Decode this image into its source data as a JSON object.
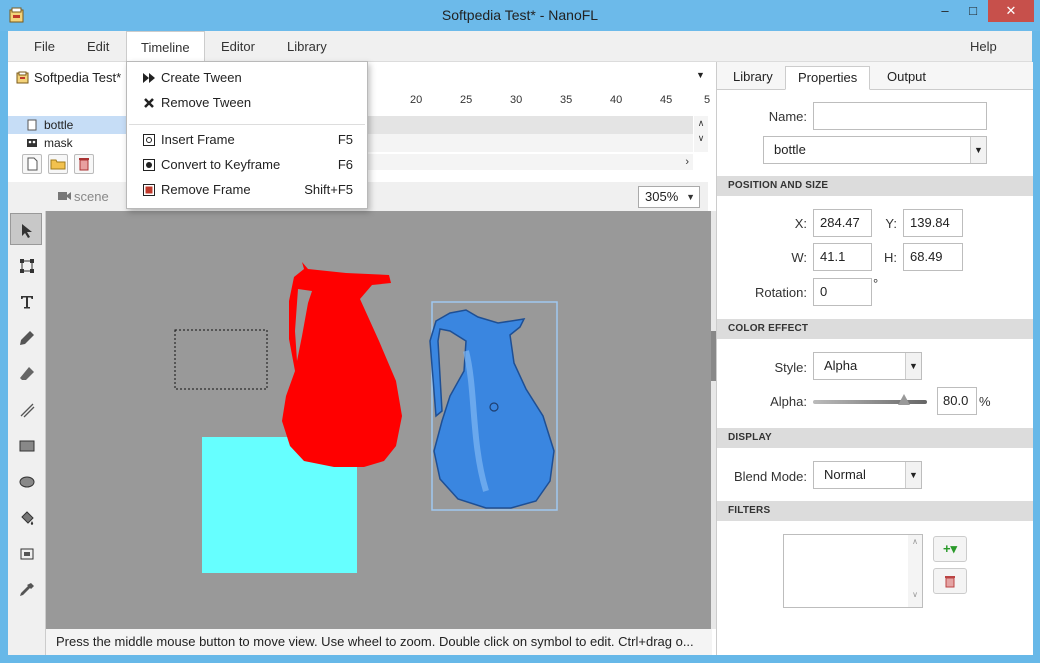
{
  "window": {
    "title": "Softpedia Test* - NanoFL",
    "minimize": "–",
    "maximize": "□",
    "close": "✕"
  },
  "menubar": {
    "items": [
      "File",
      "Edit",
      "Timeline",
      "Editor",
      "Library"
    ],
    "help": "Help"
  },
  "timeline_menu": {
    "items": [
      {
        "label": "Create Tween",
        "icon": "create-tween-icon",
        "shortcut": ""
      },
      {
        "label": "Remove Tween",
        "icon": "remove-tween-icon",
        "shortcut": ""
      },
      {
        "label": "Insert Frame",
        "icon": "insert-frame-icon",
        "shortcut": "F5"
      },
      {
        "label": "Convert to Keyframe",
        "icon": "keyframe-icon",
        "shortcut": "F6"
      },
      {
        "label": "Remove Frame",
        "icon": "remove-frame-icon",
        "shortcut": "Shift+F5"
      }
    ]
  },
  "timeline": {
    "document_tab": "Softpedia Test*",
    "ruler_ticks": [
      "20",
      "25",
      "30",
      "35",
      "40",
      "45",
      "5"
    ],
    "layers": [
      {
        "name": "bottle",
        "selected": true
      },
      {
        "name": "mask",
        "selected": false
      }
    ]
  },
  "scene": {
    "label": "scene",
    "zoom": "305%"
  },
  "tools": [
    "select-tool",
    "transform-tool",
    "text-tool",
    "pencil-tool",
    "eraser-tool",
    "line-tool",
    "rectangle-tool",
    "ellipse-tool",
    "fill-tool",
    "gradient-tool",
    "eyedropper-tool"
  ],
  "status_bar": "Press the middle mouse button to move view. Use wheel to zoom. Double click on symbol to edit. Ctrl+drag o...",
  "right_panel": {
    "tabs": [
      "Library",
      "Properties",
      "Output"
    ],
    "active_tab": "Properties",
    "name_label": "Name:",
    "name_value": "",
    "symbol_value": "bottle",
    "position_section": "POSITION AND SIZE",
    "x_label": "X:",
    "x_value": "284.47",
    "y_label": "Y:",
    "y_value": "139.84",
    "w_label": "W:",
    "w_value": "41.1",
    "h_label": "H:",
    "h_value": "68.49",
    "rotation_label": "Rotation:",
    "rotation_value": "0",
    "rotation_unit": "°",
    "color_section": "COLOR EFFECT",
    "style_label": "Style:",
    "style_value": "Alpha",
    "alpha_label": "Alpha:",
    "alpha_value": "80.0",
    "alpha_unit": "%",
    "alpha_level": 0.8,
    "display_section": "DISPLAY",
    "blend_label": "Blend Mode:",
    "blend_value": "Normal",
    "filters_section": "FILTERS",
    "add_filter": "+▾",
    "remove_filter": "🗑"
  },
  "colors": {
    "title_bar": "#6cbaea",
    "canvas_bg": "#999999",
    "red_bottle": "#ff0000",
    "cyan_rect": "#66ffff",
    "blue_bottle": "#3a86e0",
    "selection": "#9fc8f0"
  }
}
